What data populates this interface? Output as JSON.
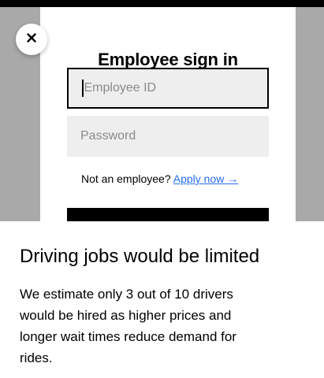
{
  "modal": {
    "title": "Employee sign in",
    "employee_id_placeholder": "Employee ID",
    "password_placeholder": "Password",
    "apply_prompt": "Not an employee?",
    "apply_link": "Apply now →",
    "close_icon": "close-icon"
  },
  "article": {
    "headline": "Driving jobs would be limited",
    "body_lines": [
      "We estimate only 3 out of 10 drivers",
      "would be hired as higher prices and",
      "longer wait times reduce demand for",
      "rides."
    ]
  },
  "colors": {
    "link": "#276ef1",
    "backdrop": "#a9a9a9",
    "field_bg": "#eeeeee"
  }
}
